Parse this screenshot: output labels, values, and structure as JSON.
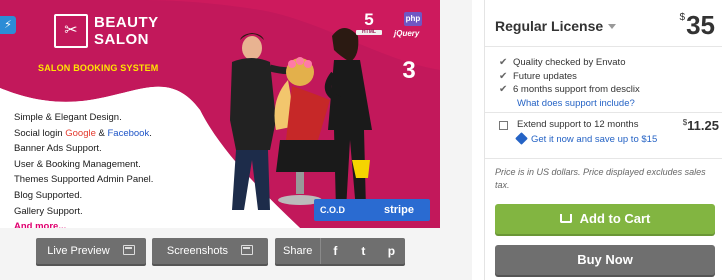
{
  "preview": {
    "brand_line1": "BEAUTY",
    "brand_line2": "SALON",
    "tagline": "SALON BOOKING SYSTEM",
    "features": [
      "Simple & Elegant Design.",
      "Banner Ads Support.",
      "User & Booking Management.",
      "Themes Supported Admin Panel.",
      "Blog Supported.",
      "Gallery Support."
    ],
    "social_prefix": "Social login ",
    "social_google": "Google",
    "social_amp": " & ",
    "social_facebook": "Facebook",
    "social_suffix": ".",
    "more": "And more...",
    "badge_html": "5",
    "badge_html_sub": "HTML",
    "badge_php": "php",
    "badge_jquery": "jQuery",
    "badge_ci": "3",
    "pay_cod": "C.O.D",
    "pay_stripe": "stripe",
    "colors": {
      "magenta": "#c2185b",
      "accent": "#ffe600"
    }
  },
  "toolbar": {
    "live_preview": "Live Preview",
    "screenshots": "Screenshots",
    "share": "Share",
    "share_facebook": "f",
    "share_twitter": "t",
    "share_pinterest": "p"
  },
  "panel": {
    "license": "Regular License",
    "currency": "$",
    "price": "35",
    "checks": [
      "Quality checked by Envato",
      "Future updates",
      "6 months support from desclix"
    ],
    "support_link": "What does support include?",
    "extend_text": "Extend support to 12 months",
    "extend_price": "11.25",
    "extend_save": "Get it now and save up to $15",
    "note": "Price is in US dollars. Price displayed excludes sales tax.",
    "add_to_cart": "Add to Cart",
    "buy_now": "Buy Now",
    "colors": {
      "cart": "#82b541",
      "link": "#2563c5",
      "dark_button": "#6f6f6f"
    }
  }
}
